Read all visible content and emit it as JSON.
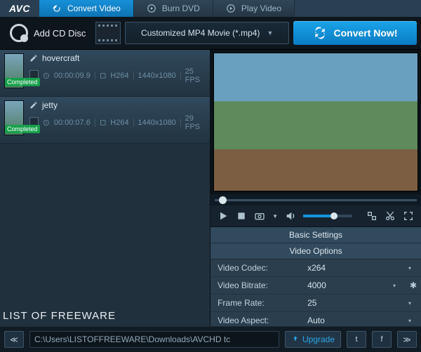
{
  "app": {
    "logo": "AVC"
  },
  "tabs": [
    {
      "label": "Convert Video",
      "active": true
    },
    {
      "label": "Burn DVD",
      "active": false
    },
    {
      "label": "Play Video",
      "active": false
    }
  ],
  "toolbar": {
    "add_cd": "Add CD Disc",
    "format": "Customized MP4 Movie (*.mp4)",
    "convert": "Convert Now!"
  },
  "list": {
    "badge": "Completed",
    "items": [
      {
        "title": "hovercraft",
        "duration": "00:00:09.9",
        "codec": "H264",
        "res": "1440x1080",
        "fps": "25 FPS"
      },
      {
        "title": "jetty",
        "duration": "00:00:07.6",
        "codec": "H264",
        "res": "1440x1080",
        "fps": "29 FPS"
      }
    ]
  },
  "watermark": "LIST OF FREEWARE",
  "settings": {
    "hdr1": "Basic Settings",
    "hdr2": "Video Options",
    "rows": {
      "codec": {
        "label": "Video Codec:",
        "value": "x264"
      },
      "bitrate": {
        "label": "Video Bitrate:",
        "value": "4000"
      },
      "fps": {
        "label": "Frame Rate:",
        "value": "25"
      },
      "aspect": {
        "label": "Video Aspect:",
        "value": "Auto"
      }
    }
  },
  "status": {
    "path": "C:\\Users\\LISTOFFREEWARE\\Downloads\\AVCHD  tc",
    "upgrade": "Upgrade"
  }
}
